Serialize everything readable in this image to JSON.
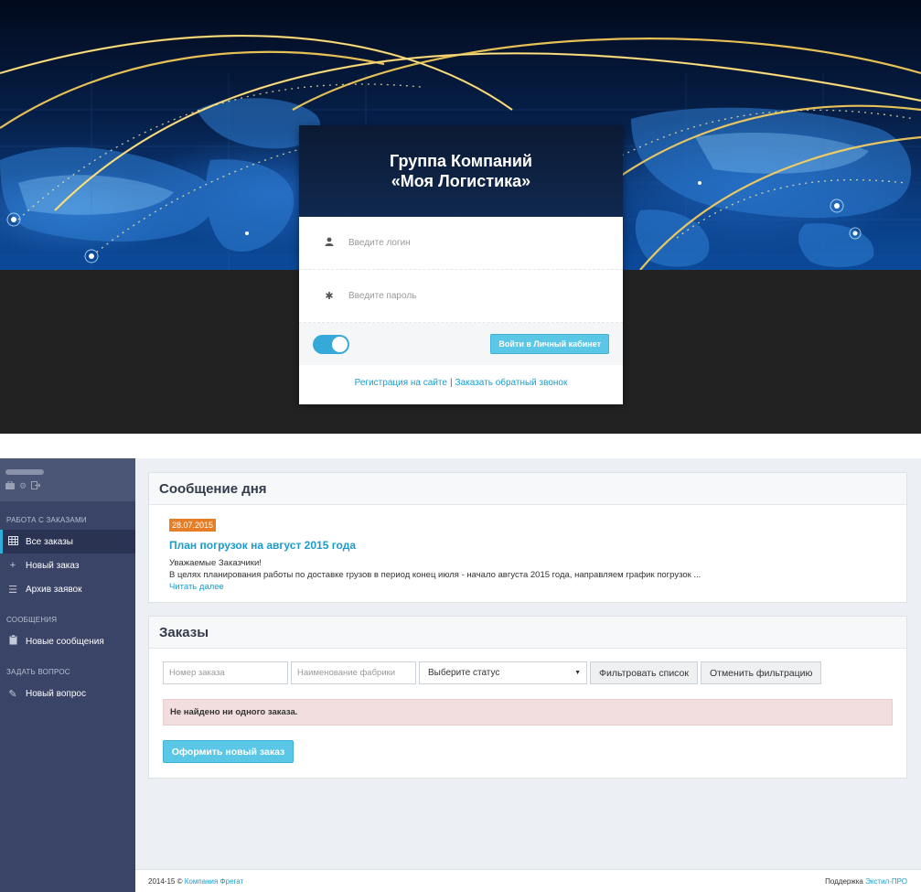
{
  "login": {
    "company_line1": "Группа Компаний",
    "company_line2": "«Моя Логистика»",
    "login_placeholder": "Введите логин",
    "password_placeholder": "Введите пароль",
    "login_icon": "user-icon",
    "password_icon": "asterisk-icon",
    "remember_toggle_on": true,
    "submit_label": "Войти в Личный кабинет",
    "register_link": "Регистрация на сайте",
    "separator": "|",
    "callback_link": "Заказать обратный звонок",
    "accent_color": "#5bc7e6"
  },
  "sidebar": {
    "top_icons": [
      "briefcase-icon",
      "gear-icon",
      "logout-icon"
    ],
    "sections": [
      {
        "title": "РАБОТА С ЗАКАЗАМИ",
        "items": [
          {
            "label": "Все заказы",
            "icon": "table-icon",
            "active": true
          },
          {
            "label": "Новый заказ",
            "icon": "plus-icon",
            "active": false
          },
          {
            "label": "Архив заявок",
            "icon": "list-icon",
            "active": false
          }
        ]
      },
      {
        "title": "СООБЩЕНИЯ",
        "items": [
          {
            "label": "Новые сообщения",
            "icon": "clipboard-icon",
            "active": false
          }
        ]
      },
      {
        "title": "ЗАДАТЬ ВОПРОС",
        "items": [
          {
            "label": "Новый вопрос",
            "icon": "pencil-icon",
            "active": false
          }
        ]
      }
    ]
  },
  "message_of_day": {
    "heading": "Сообщение дня",
    "date": "28.07.2015",
    "title": "План погрузок на август 2015 года",
    "greeting": "Уважаемые Заказчики!",
    "text": "В целях планирования работы по доставке грузов в период конец июля - начало августа 2015 года, направляем график погрузок ...",
    "read_more": "Читать далее"
  },
  "orders": {
    "heading": "Заказы",
    "order_number_placeholder": "Номер заказа",
    "factory_placeholder": "Наименование фабрики",
    "status_select": "Выберите статус",
    "filter_button": "Фильтровать список",
    "reset_button": "Отменить фильтрацию",
    "empty_alert": "Не найдено ни одного заказа.",
    "new_order_button": "Оформить новый заказ"
  },
  "footer": {
    "copyright": "2014-15 ©",
    "company_link": "Компания Фрегат",
    "support_label": "Поддержка",
    "support_link": "Экстил-ПРО"
  }
}
